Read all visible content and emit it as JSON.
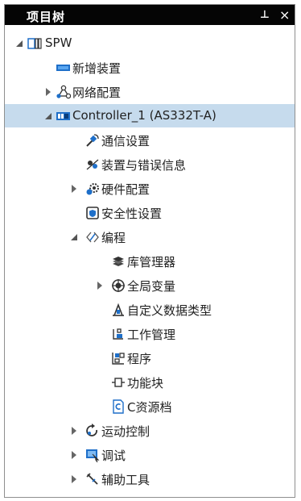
{
  "panel": {
    "title": "项目树",
    "pin_glyph": "⊥",
    "close_glyph": "×"
  },
  "tree": {
    "root": "SPW",
    "add_device": "新增装置",
    "network_config": "网络配置",
    "controller": "Controller_1 (AS332T-A)",
    "comm_settings": "通信设置",
    "device_error_info": "装置与错误信息",
    "hardware_config": "硬件配置",
    "security_settings": "安全性设置",
    "programming": "编程",
    "library_manager": "库管理器",
    "global_variables": "全局变量",
    "custom_data_types": "自定义数据类型",
    "task_management": "工作管理",
    "program": "程序",
    "function_block": "功能块",
    "c_source": "C资源档",
    "motion_control": "运动控制",
    "debug": "调试",
    "aux_tools": "辅助工具"
  },
  "colors": {
    "title_bg": "#050505",
    "selection": "#c6dbed",
    "accent_blue": "#1e6fc9"
  }
}
